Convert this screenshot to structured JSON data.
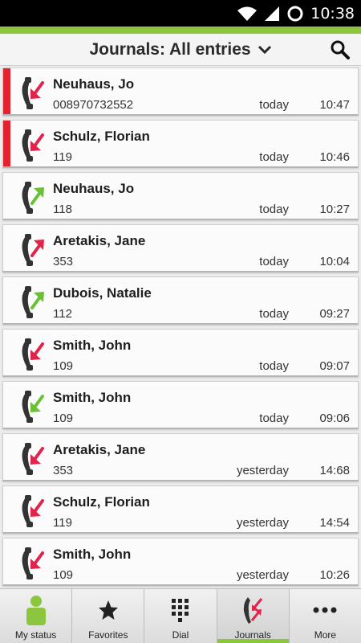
{
  "status_bar": {
    "time": "10:38",
    "icons": [
      "wifi-icon",
      "signal-icon",
      "battery-icon"
    ]
  },
  "header": {
    "title": "Journals: All entries",
    "dropdown_icon": "chevron-down-icon",
    "search_icon": "search-icon"
  },
  "colors": {
    "accent": "#8cc63f",
    "missed": "#e2232f",
    "incoming_arrow": "#e2234a",
    "outgoing_arrow": "#6cc035"
  },
  "entries": [
    {
      "name": "Neuhaus, Jo",
      "number": "008970732552",
      "day": "today",
      "time": "10:47",
      "direction": "incoming",
      "missed": true
    },
    {
      "name": "Schulz, Florian",
      "number": "119",
      "day": "today",
      "time": "10:46",
      "direction": "incoming",
      "missed": true
    },
    {
      "name": "Neuhaus, Jo",
      "number": "118",
      "day": "today",
      "time": "10:27",
      "direction": "outgoing",
      "missed": false
    },
    {
      "name": "Aretakis, Jane",
      "number": "353",
      "day": "today",
      "time": "10:04",
      "direction": "outgoing-red",
      "missed": false
    },
    {
      "name": "Dubois, Natalie",
      "number": "112",
      "day": "today",
      "time": "09:27",
      "direction": "outgoing",
      "missed": false
    },
    {
      "name": "Smith, John",
      "number": "109",
      "day": "today",
      "time": "09:07",
      "direction": "incoming",
      "missed": false
    },
    {
      "name": "Smith, John",
      "number": "109",
      "day": "today",
      "time": "09:06",
      "direction": "incoming-green",
      "missed": false
    },
    {
      "name": "Aretakis, Jane",
      "number": "353",
      "day": "yesterday",
      "time": "14:68",
      "direction": "incoming",
      "missed": false
    },
    {
      "name": "Schulz, Florian",
      "number": "119",
      "day": "yesterday",
      "time": "14:54",
      "direction": "incoming",
      "missed": false
    },
    {
      "name": "Smith, John",
      "number": "109",
      "day": "yesterday",
      "time": "10:26",
      "direction": "incoming",
      "missed": false
    }
  ],
  "bottom_nav": [
    {
      "label": "My status",
      "icon": "person-status-icon",
      "active": false
    },
    {
      "label": "Favorites",
      "icon": "star-icon",
      "active": false
    },
    {
      "label": "Dial",
      "icon": "dialpad-icon",
      "active": false
    },
    {
      "label": "Journals",
      "icon": "journal-calls-icon",
      "active": true
    },
    {
      "label": "More",
      "icon": "more-icon",
      "active": false
    }
  ]
}
